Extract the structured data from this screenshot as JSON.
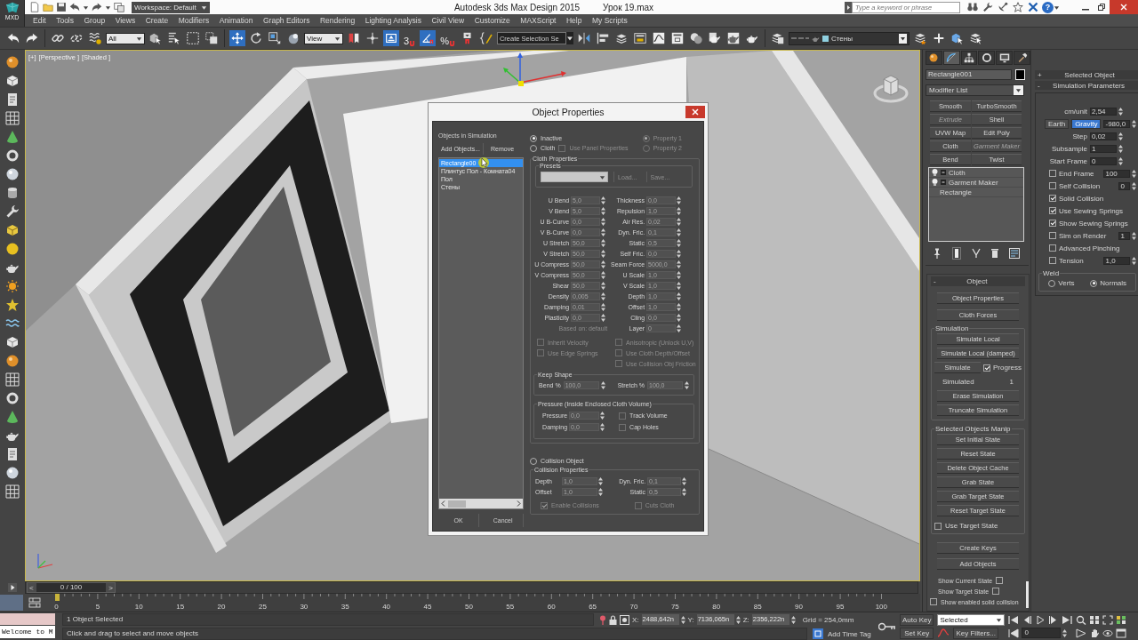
{
  "title_bar": {
    "app_button": "MXD",
    "workspace": "Workspace: Default",
    "app_title": "Autodesk 3ds Max Design 2015",
    "file_title": "Урок 19.max",
    "search": {
      "placeholder": "Type a keyword or phrase"
    },
    "help": "?"
  },
  "menu": [
    "Edit",
    "Tools",
    "Group",
    "Views",
    "Create",
    "Modifiers",
    "Animation",
    "Graph Editors",
    "Rendering",
    "Lighting Analysis",
    "Civil View",
    "Customize",
    "MAXScript",
    "Help",
    "My Scripts"
  ],
  "main_toolbar": {
    "tools": [
      {
        "kind": "undo",
        "selected": false
      },
      {
        "kind": "redo",
        "selected": false
      },
      {
        "kind": "separator"
      },
      {
        "kind": "link",
        "selected": false
      },
      {
        "kind": "unlink",
        "selected": false
      },
      {
        "kind": "bind",
        "selected": false
      },
      {
        "kind": "dropdown",
        "value": "All"
      },
      {
        "kind": "select",
        "selected": false
      },
      {
        "kind": "byname",
        "selected": false
      },
      {
        "kind": "rect",
        "selected": false
      },
      {
        "kind": "window",
        "selected": false
      },
      {
        "kind": "separator"
      },
      {
        "kind": "move",
        "selected": true
      },
      {
        "kind": "rotate",
        "selected": false
      },
      {
        "kind": "scale",
        "selected": false
      },
      {
        "kind": "place",
        "selected": false
      },
      {
        "kind": "dropdown",
        "value": "View"
      },
      {
        "kind": "pivot",
        "selected": false
      },
      {
        "kind": "manip",
        "selected": false
      },
      {
        "kind": "kbd",
        "selected": true
      },
      {
        "kind": "snap",
        "label": "3",
        "selected": false
      },
      {
        "kind": "angle",
        "selected": true
      },
      {
        "kind": "snap",
        "label": "%",
        "selected": false
      },
      {
        "kind": "spinsnap",
        "selected": false
      },
      {
        "kind": "namedsel",
        "selected": false
      },
      {
        "kind": "field",
        "placeholder": "Create Selection Se"
      },
      {
        "kind": "mirror",
        "selected": false
      },
      {
        "kind": "align",
        "selected": false
      },
      {
        "kind": "layers",
        "selected": false
      },
      {
        "kind": "ribbon",
        "selected": false
      },
      {
        "kind": "curve",
        "selected": false
      },
      {
        "kind": "schematic",
        "selected": false
      },
      {
        "kind": "material",
        "selected": false
      },
      {
        "kind": "rsetup",
        "selected": false
      },
      {
        "kind": "rframe",
        "selected": false
      },
      {
        "kind": "render",
        "selected": false
      },
      {
        "kind": "separator"
      },
      {
        "kind": "layerbtn",
        "selected": false
      },
      {
        "kind": "layer_dropdown",
        "value": "Стены"
      },
      {
        "kind": "newlayer",
        "selected": false
      },
      {
        "kind": "plus",
        "selected": false
      },
      {
        "kind": "selcube",
        "selected": false
      },
      {
        "kind": "layersel",
        "selected": false
      }
    ]
  },
  "viewport": {
    "labels": [
      "[+]",
      "[Perspective ]",
      "[Shaded ]"
    ]
  },
  "dialog": {
    "title": "Object Properties",
    "objects": {
      "label": "Objects in Simulation",
      "add": "Add Objects...",
      "remove": "Remove",
      "items": [
        {
          "name": "Rectangle00",
          "selected": true
        },
        {
          "name": "Плинтус Пол - Комната04",
          "selected": false
        },
        {
          "name": "Пол",
          "selected": false
        },
        {
          "name": "Стены",
          "selected": false
        }
      ]
    },
    "mode": [
      {
        "label": "Inactive",
        "selected": true
      },
      {
        "label": "Cloth",
        "selected": false,
        "option": {
          "label": "Use Panel Properties",
          "checked": false,
          "disabled": true
        }
      }
    ],
    "property_sets": [
      {
        "label": "Property 1",
        "selected": true,
        "disabled": true
      },
      {
        "label": "Property 2",
        "selected": false,
        "disabled": true
      }
    ],
    "cloth_properties": {
      "title": "Cloth Properties",
      "disabled": true,
      "presets": {
        "title": "Presets",
        "load": "Load...",
        "save": "Save..."
      },
      "left": [
        {
          "label": "U Bend",
          "value": "5,0"
        },
        {
          "label": "V Bend",
          "value": "5,0"
        },
        {
          "label": "U B-Curve",
          "value": "0,0"
        },
        {
          "label": "V B-Curve",
          "value": "0,0"
        },
        {
          "label": "U Stretch",
          "value": "50,0"
        },
        {
          "label": "V Stretch",
          "value": "50,0"
        },
        {
          "label": "U Compress",
          "value": "50,0"
        },
        {
          "label": "V Compress",
          "value": "50,0"
        },
        {
          "label": "Shear",
          "value": "50,0"
        },
        {
          "label": "Density",
          "value": "0,005"
        },
        {
          "label": "Damping",
          "value": "0,01"
        },
        {
          "label": "Plasticity",
          "value": "0,0"
        }
      ],
      "right": [
        {
          "label": "Thickness",
          "value": "0,0"
        },
        {
          "label": "Repulsion",
          "value": "1,0"
        },
        {
          "label": "Air Res.",
          "value": "0,02"
        },
        {
          "label": "Dyn. Fric.",
          "value": "0,1"
        },
        {
          "label": "Static",
          "value": "0,5"
        },
        {
          "label": "Self Fric.",
          "value": "0,0"
        },
        {
          "label": "Seam Force",
          "value": "5000,0"
        },
        {
          "label": "U Scale",
          "value": "1,0"
        },
        {
          "label": "V Scale",
          "value": "1,0"
        },
        {
          "label": "Depth",
          "value": "1,0"
        },
        {
          "label": "Offset",
          "value": "1,0"
        },
        {
          "label": "Cling",
          "value": "0,0"
        },
        {
          "label": "Layer",
          "value": "0"
        }
      ],
      "based_on": "Based on: default",
      "options_left": [
        {
          "label": "Inherit Velocity",
          "checked": false
        },
        {
          "label": "Use Edge Springs",
          "checked": false
        }
      ],
      "options_right": [
        {
          "label": "Anisotropic (Unlock U,V)",
          "checked": false
        },
        {
          "label": "Use Cloth Depth/Offset",
          "checked": false
        },
        {
          "label": "Use Collision Obj Friction",
          "checked": false
        }
      ],
      "keep_shape": {
        "title": "Keep Shape",
        "fields": [
          {
            "label": "Bend %",
            "value": "100,0"
          },
          {
            "label": "Stretch %",
            "value": "100,0"
          }
        ]
      },
      "pressure": {
        "title": "Pressure (Inside Enclosed Cloth Volume)",
        "fields": [
          {
            "label": "Pressure",
            "value": "0,0"
          },
          {
            "label": "Damping",
            "value": "0,0"
          }
        ],
        "options": [
          {
            "label": "Track Volume",
            "checked": false
          },
          {
            "label": "Cap Holes",
            "checked": false
          }
        ]
      }
    },
    "collision_object": {
      "label": "Collision Object",
      "selected": false
    },
    "collision_properties": {
      "title": "Collision Properties",
      "disabled": true,
      "left": [
        {
          "label": "Depth",
          "value": "1,0"
        },
        {
          "label": "Offset",
          "value": "1,0"
        }
      ],
      "right": [
        {
          "label": "Dyn. Fric.",
          "value": "0,1"
        },
        {
          "label": "Static",
          "value": "0,5"
        }
      ],
      "options": [
        {
          "label": "Enable Collisions",
          "checked": true
        },
        {
          "label": "Cuts Cloth",
          "checked": false
        }
      ]
    },
    "ok": "OK",
    "cancel": "Cancel"
  },
  "command_panel": {
    "tabs": [
      {
        "kind": "create",
        "selected": false
      },
      {
        "kind": "modify",
        "selected": true
      },
      {
        "kind": "hierarchy",
        "selected": false
      },
      {
        "kind": "motion",
        "selected": false
      },
      {
        "kind": "display",
        "selected": false
      },
      {
        "kind": "utilities",
        "selected": false
      }
    ],
    "object_name": "Rectangle001",
    "modifier_list": "Modifier List",
    "modifier_buttons": [
      {
        "label": "Smooth",
        "disabled": false
      },
      {
        "label": "TurboSmooth",
        "disabled": false
      },
      {
        "label": "Extrude",
        "disabled": true
      },
      {
        "label": "Shell",
        "disabled": false
      },
      {
        "label": "UVW Map",
        "disabled": false
      },
      {
        "label": "Edit Poly",
        "disabled": false
      },
      {
        "label": "Cloth",
        "disabled": false
      },
      {
        "label": "Garment Maker",
        "disabled": true
      },
      {
        "label": "Bend",
        "disabled": false
      },
      {
        "label": "Twist",
        "disabled": false
      }
    ],
    "stack": [
      {
        "kind": "modifier",
        "label": "Cloth"
      },
      {
        "kind": "modifier",
        "label": "Garment Maker"
      },
      {
        "kind": "base",
        "label": "Rectangle"
      }
    ],
    "object_rollout": {
      "sign": "-",
      "title": "Object",
      "buttons": [
        "Object Properties",
        "Cloth Forces"
      ],
      "simulation": {
        "title": "Simulation",
        "buttons": [
          "Simulate Local",
          "Simulate Local (damped)"
        ],
        "simulate": "Simulate",
        "progress": {
          "label": "Progress",
          "checked": true
        },
        "simulated_label": "Simulated",
        "simulated_value": "1",
        "after": [
          "Erase Simulation",
          "Truncate Simulation"
        ]
      },
      "manip": {
        "title": "Selected Objects Manip",
        "buttons": [
          "Set Initial State",
          "Reset State",
          "Delete Object Cache",
          "Grab State",
          "Grab Target State",
          "Reset Target State"
        ],
        "use_target": {
          "label": "Use Target State",
          "checked": false
        }
      },
      "keys": [
        "Create Keys",
        "Add Objects"
      ],
      "show_options": [
        {
          "kind": "trailing",
          "label": "Show Current State",
          "checked": false
        },
        {
          "kind": "trailing",
          "label": "Show Target State",
          "checked": false
        },
        {
          "kind": "leading",
          "label": "Show enabled solid collision",
          "checked": false
        }
      ]
    },
    "sim_params": {
      "collapsed": {
        "sign": "+",
        "title": "Selected Object"
      },
      "sign": "-",
      "title": "Simulation Parameters",
      "rows": [
        {
          "kind": "spinner",
          "label": "cm/unit",
          "value": "2,54"
        },
        {
          "kind": "gravity",
          "earth": "Earth",
          "label": "Gravity",
          "on": true,
          "value": "-980,0"
        },
        {
          "kind": "spinner",
          "label": "Step",
          "value": "0,02"
        },
        {
          "kind": "spinner",
          "label": "Subsample",
          "value": "1"
        },
        {
          "kind": "spinner",
          "label": "Start Frame",
          "value": "0"
        },
        {
          "kind": "check_spinner",
          "label": "End Frame",
          "checked": false,
          "value": "100"
        },
        {
          "kind": "check_count",
          "label": "Self Collision",
          "checked": false,
          "value": "0"
        },
        {
          "kind": "check",
          "label": "Solid Collision",
          "checked": true
        },
        {
          "kind": "check",
          "label": "Use Sewing Springs",
          "checked": true
        },
        {
          "kind": "check",
          "label": "Show Sewing Springs",
          "checked": true
        },
        {
          "kind": "check_count",
          "label": "Sim on Render",
          "checked": false,
          "value": "1"
        },
        {
          "kind": "check",
          "label": "Advanced Pinching",
          "checked": false
        },
        {
          "kind": "check_spinner",
          "label": "Tension",
          "checked": false,
          "value": "1,0"
        }
      ],
      "weld": {
        "title": "Weld",
        "options": [
          {
            "label": "Verts",
            "selected": false
          },
          {
            "label": "Normals",
            "selected": true
          }
        ]
      }
    }
  },
  "time_slider": {
    "prev": "<",
    "position": "0 / 100",
    "next": ">",
    "level": 0
  },
  "track_bar": {
    "ticks": [
      "0",
      "5",
      "10",
      "15",
      "20",
      "25",
      "30",
      "35",
      "40",
      "45",
      "50",
      "55",
      "60",
      "65",
      "70",
      "75",
      "80",
      "85",
      "90",
      "95",
      "100"
    ]
  },
  "status_bar": {
    "listener": "Welcome to M",
    "selection": "1 Object Selected",
    "prompt": "Click and drag to select and move objects",
    "coords": [
      {
        "axis": "X:",
        "value": "2488,642n"
      },
      {
        "axis": "Y:",
        "value": "7136,065n"
      },
      {
        "axis": "Z:",
        "value": "2356,222n"
      }
    ],
    "grid": "Grid = 254,0mm",
    "time_tag": "Add Time Tag",
    "auto_key": "Auto Key",
    "set_key": "Set Key",
    "key_mode": "Selected",
    "key_filters": "Key Filters...",
    "frame": "0"
  }
}
